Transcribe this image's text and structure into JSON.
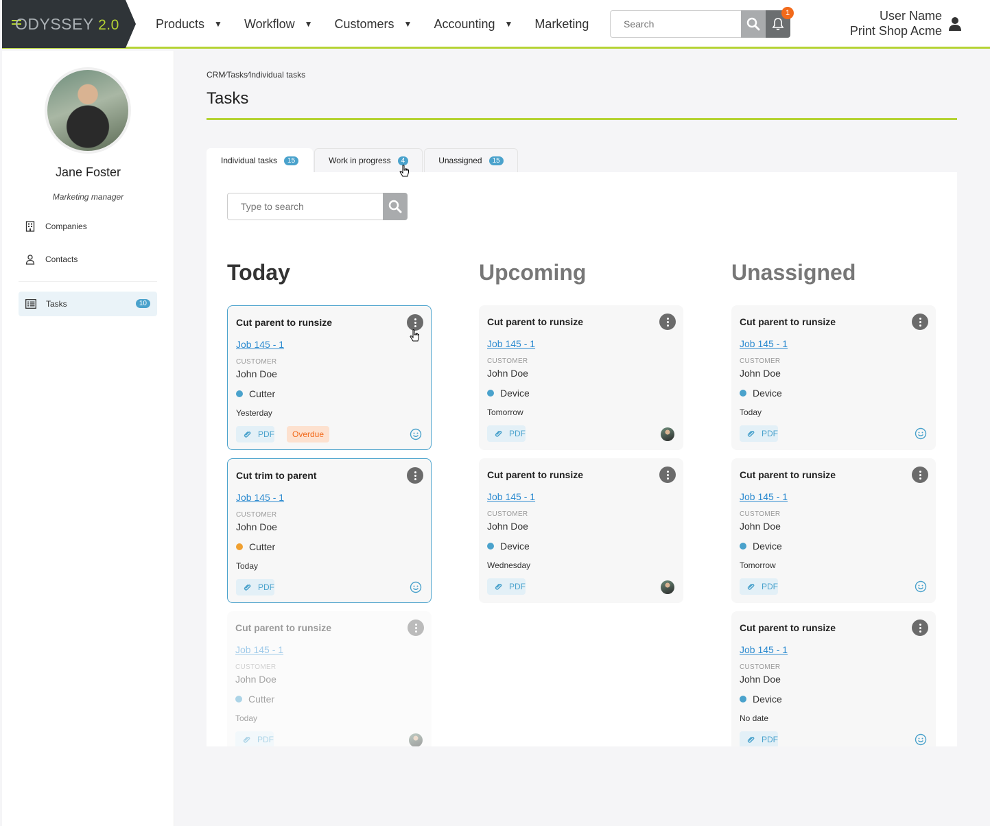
{
  "app": {
    "logo_text": "DYSSEY",
    "logo_version": "2.0",
    "brand_color": "#b5d334",
    "accent_color": "#4aa2cc"
  },
  "nav": {
    "items": [
      {
        "label": "Products",
        "has_caret": true
      },
      {
        "label": "Workflow",
        "has_caret": true
      },
      {
        "label": "Customers",
        "has_caret": true
      },
      {
        "label": "Accounting",
        "has_caret": true
      },
      {
        "label": "Marketing",
        "has_caret": false
      }
    ],
    "search_placeholder": "Search",
    "notification_count": "1",
    "user_name": "User Name",
    "company": "Print Shop Acme"
  },
  "sidebar": {
    "profile_name": "Jane Foster",
    "profile_role": "Marketing manager",
    "links": [
      {
        "label": "Companies",
        "icon": "building-icon"
      },
      {
        "label": "Contacts",
        "icon": "person-icon"
      }
    ],
    "tasks": {
      "label": "Tasks",
      "count": "10",
      "icon": "list-icon"
    }
  },
  "breadcrumb": {
    "items": [
      "CRM",
      "Tasks",
      "Individual tasks"
    ],
    "separator": "⁄"
  },
  "page_title": "Tasks",
  "tabs": [
    {
      "label": "Individual tasks",
      "count": "15",
      "active": true
    },
    {
      "label": "Work in progress",
      "count": "4",
      "active": false
    },
    {
      "label": "Unassigned",
      "count": "15",
      "active": false
    }
  ],
  "panel_search_placeholder": "Type to search",
  "columns": [
    {
      "title": "Today",
      "cards": [
        {
          "title": "Cut parent to runsize",
          "job": "Job 145 - 1",
          "customer_label": "CUSTOMER",
          "customer": "John Doe",
          "device": "Cutter",
          "status": "ok",
          "date": "Yesterday",
          "pdf": "PDF",
          "overdue": "Overdue",
          "assignee": "smiley-icon",
          "selected": true,
          "faded": false
        },
        {
          "title": "Cut trim to parent",
          "job": "Job 145 - 1",
          "customer_label": "CUSTOMER",
          "customer": "John Doe",
          "device": "Cutter",
          "status": "warn",
          "date": "Today",
          "pdf": "PDF",
          "overdue": "",
          "assignee": "smiley-icon",
          "selected": true,
          "faded": false
        },
        {
          "title": "Cut parent to runsize",
          "job": "Job 145 - 1",
          "customer_label": "CUSTOMER",
          "customer": "John Doe",
          "device": "Cutter",
          "status": "ok",
          "date": "Today",
          "pdf": "PDF",
          "overdue": "",
          "assignee": "avatar",
          "selected": false,
          "faded": true
        }
      ]
    },
    {
      "title": "Upcoming",
      "cards": [
        {
          "title": "Cut parent to runsize",
          "job": "Job 145 - 1",
          "customer_label": "CUSTOMER",
          "customer": "John Doe",
          "device": "Device",
          "status": "ok",
          "date": "Tomorrow",
          "pdf": "PDF",
          "overdue": "",
          "assignee": "avatar",
          "selected": false,
          "faded": false
        },
        {
          "title": "Cut parent to runsize",
          "job": "Job 145 - 1",
          "customer_label": "CUSTOMER",
          "customer": "John Doe",
          "device": "Device",
          "status": "ok",
          "date": "Wednesday",
          "pdf": "PDF",
          "overdue": "",
          "assignee": "avatar",
          "selected": false,
          "faded": false
        }
      ]
    },
    {
      "title": "Unassigned",
      "cards": [
        {
          "title": "Cut parent to runsize",
          "job": "Job 145 - 1",
          "customer_label": "CUSTOMER",
          "customer": "John Doe",
          "device": "Device",
          "status": "ok",
          "date": "Today",
          "pdf": "PDF",
          "overdue": "",
          "assignee": "smiley-icon",
          "selected": false,
          "faded": false
        },
        {
          "title": "Cut parent to runsize",
          "job": "Job 145 - 1",
          "customer_label": "CUSTOMER",
          "customer": "John Doe",
          "device": "Device",
          "status": "ok",
          "date": "Tomorrow",
          "pdf": "PDF",
          "overdue": "",
          "assignee": "smiley-icon",
          "selected": false,
          "faded": false
        },
        {
          "title": "Cut parent to runsize",
          "job": "Job 145 - 1",
          "customer_label": "CUSTOMER",
          "customer": "John Doe",
          "device": "Device",
          "status": "ok",
          "date": "No date",
          "pdf": "PDF",
          "overdue": "",
          "assignee": "smiley-icon",
          "selected": false,
          "faded": false
        }
      ]
    }
  ]
}
